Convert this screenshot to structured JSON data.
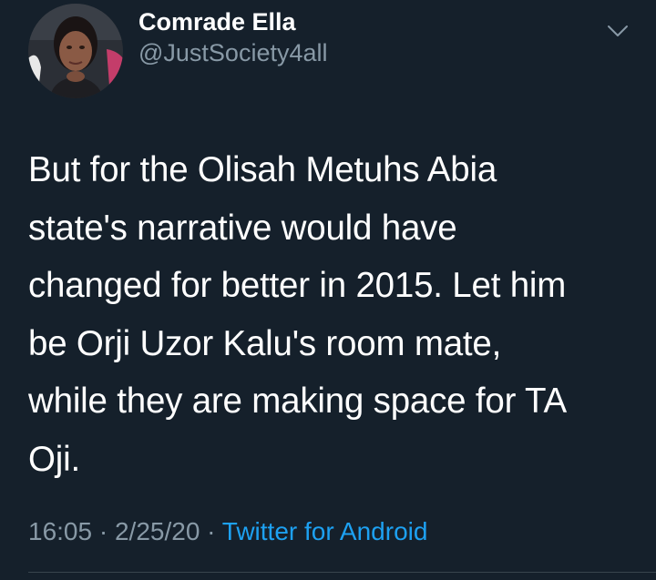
{
  "user": {
    "display_name": "Comrade Ella",
    "handle": "@JustSociety4all"
  },
  "tweet": {
    "text": "But for the Olisah Metuhs Abia\nstate's narrative would have\nchanged for better in 2015.  Let him\nbe Orji Uzor Kalu's room mate,\nwhile they are making space for TA\nOji.",
    "time": "16:05",
    "separator": " · ",
    "date": "2/25/20",
    "source": "Twitter for Android"
  },
  "colors": {
    "background": "#15202b",
    "text": "#ffffff",
    "muted": "#8899a6",
    "accent": "#1da1f2",
    "divider": "#38444d"
  },
  "icons": {
    "avatar": "avatar",
    "menu": "chevron-down-icon"
  }
}
